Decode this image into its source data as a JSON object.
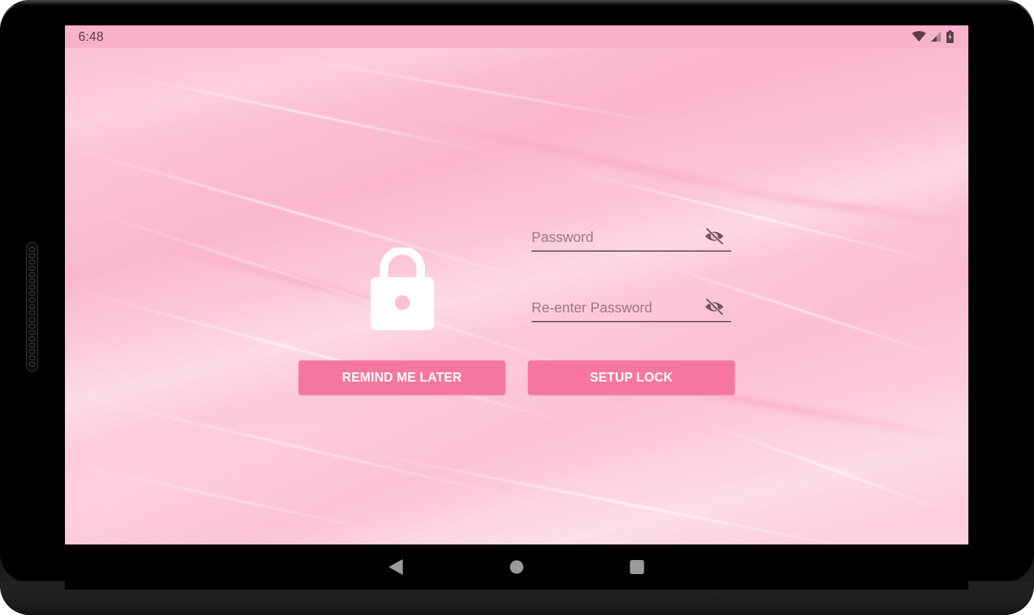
{
  "status_bar": {
    "time": "6:48",
    "icons": [
      "wifi-icon",
      "cellular-signal-icon",
      "battery-charging-icon"
    ]
  },
  "lock_screen": {
    "icon": "lock-icon",
    "password_field": {
      "value": "",
      "placeholder": "Password",
      "visibility_icon": "eye-off-icon"
    },
    "reenter_password_field": {
      "value": "",
      "placeholder": "Re-enter Password",
      "visibility_icon": "eye-off-icon"
    },
    "remind_later_label": "REMIND ME LATER",
    "setup_lock_label": "SETUP LOCK"
  },
  "navigation_bar": {
    "back": "back-icon",
    "home": "home-icon",
    "recents": "recents-icon"
  },
  "colors": {
    "accent_button": "#f5779f",
    "status_bar": "#f9b2cb",
    "background": "#fbc3d5",
    "icon_dark": "#5a3c4a"
  }
}
